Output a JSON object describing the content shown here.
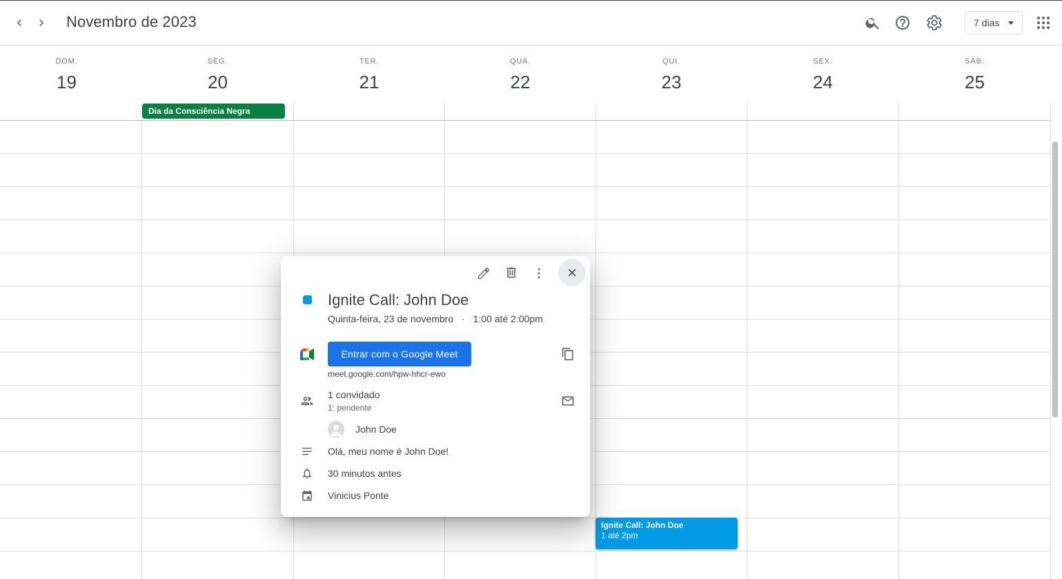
{
  "header": {
    "title": "Novembro de 2023",
    "view_label": "7 dias",
    "icons": [
      "chevron-left-icon",
      "chevron-right-icon",
      "search-icon",
      "help-icon",
      "settings-icon",
      "apps-grid-icon"
    ]
  },
  "days": [
    {
      "dow": "DOM.",
      "num": "19"
    },
    {
      "dow": "SEG.",
      "num": "20"
    },
    {
      "dow": "TER.",
      "num": "21"
    },
    {
      "dow": "QUA.",
      "num": "22"
    },
    {
      "dow": "QUI.",
      "num": "23"
    },
    {
      "dow": "SEX.",
      "num": "24"
    },
    {
      "dow": "SÁB.",
      "num": "25"
    }
  ],
  "allday_event": {
    "title": "Dia da Consciência Negra",
    "color": "#0b8043"
  },
  "timed_event": {
    "title": "Ignite Call: John Doe",
    "time": "1 até 2pm",
    "color": "#039be5"
  },
  "popup": {
    "title": "Ignite Call: John Doe",
    "date": "Quinta-feira, 23 de novembro",
    "separator": "·",
    "time": "1:00 até 2:00pm",
    "meet_button": "Entrar com o Google Meet",
    "meet_link": "meet.google.com/hpw-hhcr-ewo",
    "guests_count": "1 convidado",
    "guests_status": "1: pendente",
    "guest_name": "John Doe",
    "description": "Olá, meu nome é John Doe!",
    "reminder": "30 minutos antes",
    "calendar_owner": "Vinicius Ponte",
    "color": "#039be5",
    "meet_button_color": "#1a73e8"
  }
}
